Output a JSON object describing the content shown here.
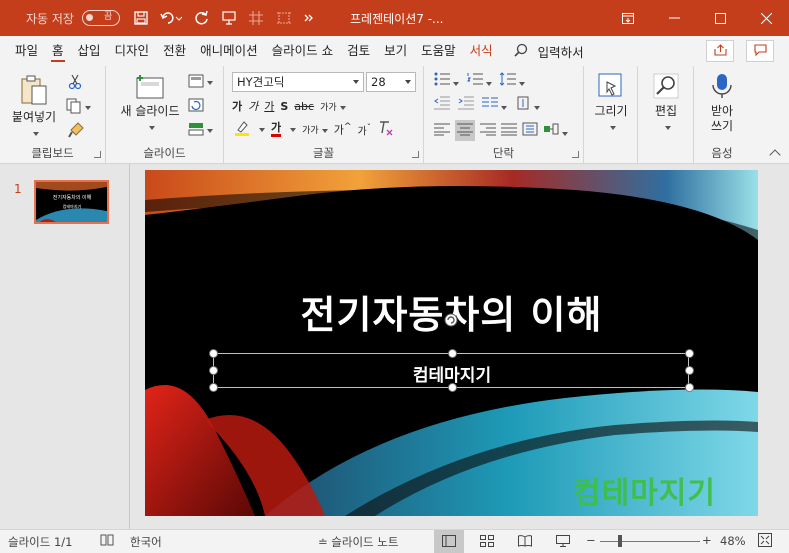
{
  "titlebar": {
    "autosave_label": "자동 저장",
    "autosave_state": "끔",
    "doc_title": "프레젠테이션7  -..."
  },
  "tabs": [
    {
      "label": "파일"
    },
    {
      "label": "홈"
    },
    {
      "label": "삽입"
    },
    {
      "label": "디자인"
    },
    {
      "label": "전환"
    },
    {
      "label": "애니메이션"
    },
    {
      "label": "슬라이드 쇼"
    },
    {
      "label": "검토"
    },
    {
      "label": "보기"
    },
    {
      "label": "도움말"
    },
    {
      "label": "서식"
    }
  ],
  "tellme": {
    "label": "입력하서"
  },
  "ribbon": {
    "clipboard": {
      "paste": "붙여넣기",
      "label": "클립보드"
    },
    "slides": {
      "new_slide": "새 슬라이드",
      "label": "슬라이드"
    },
    "font": {
      "name": "HY견고딕",
      "size": "28",
      "label": "글꼴"
    },
    "paragraph": {
      "label": "단락"
    },
    "drawing": {
      "label": "그리기"
    },
    "editing": {
      "label": "편집"
    },
    "voice": {
      "dictate": "받아 쓰기",
      "label": "음성"
    }
  },
  "slide_pane": {
    "number": "1",
    "thumb_title": "전기자동차의 이해",
    "thumb_sub": "컴테마지기"
  },
  "slide": {
    "title": "전기자동차의 이해",
    "subtitle": "컴테마지기",
    "watermark": "컴테마지기"
  },
  "status": {
    "slide_count": "슬라이드 1/1",
    "language": "한국어",
    "notes": "슬라이드 노트",
    "zoom": "48%"
  },
  "colors": {
    "accent": "#c43e1c",
    "watermark": "#3fbf4a"
  }
}
